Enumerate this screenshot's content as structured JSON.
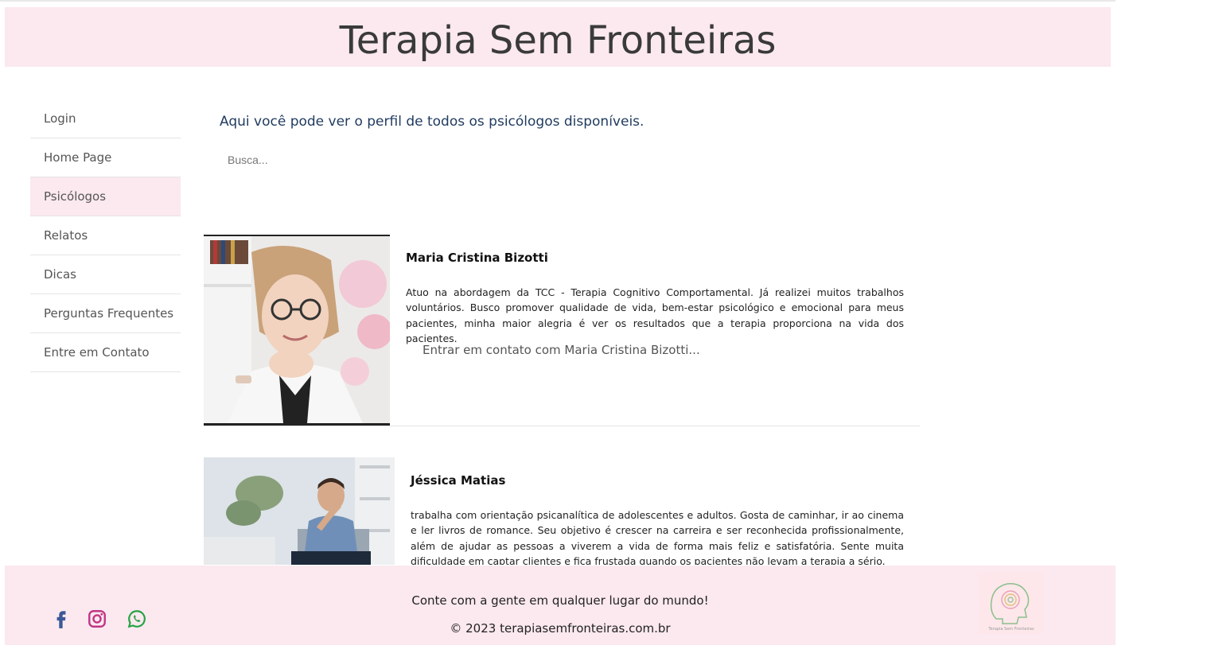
{
  "header": {
    "title": "Terapia Sem Fronteiras"
  },
  "sidebar": {
    "items": [
      {
        "label": "Login"
      },
      {
        "label": "Home Page"
      },
      {
        "label": "Psicólogos",
        "active": true
      },
      {
        "label": "Relatos"
      },
      {
        "label": "Dicas"
      },
      {
        "label": "Perguntas Frequentes"
      },
      {
        "label": "Entre em Contato"
      }
    ]
  },
  "main": {
    "intro": "Aqui você pode ver o perfil de todos os psicólogos disponíveis.",
    "search": {
      "placeholder": "Busca...",
      "value": ""
    }
  },
  "psychologists": [
    {
      "name": "Maria Cristina Bizotti",
      "description": "Atuo na abordagem da TCC - Terapia Cognitivo Comportamental. Já realizei muitos trabalhos voluntários. Busco promover qualidade de vida, bem-estar psicológico e emocional para meus pacientes, minha maior alegria é ver os resultados que a terapia proporciona na vida dos pacientes.",
      "contact": "Entrar em contato com Maria Cristina Bizotti..."
    },
    {
      "name": "Jéssica Matias",
      "description": "trabalha com orientação psicanalítica de adolescentes e adultos. Gosta de caminhar, ir ao cinema e ler livros de romance. Seu objetivo é crescer na carreira e ser reconhecida profissionalmente, além de ajudar as pessoas a viverem a vida de forma mais feliz e satisfatória. Sente muita dificuldade em captar clientes e fica frustada quando os pacientes não levam a terapia a sério."
    }
  ],
  "footer": {
    "message": "Conte com a gente em qualquer lugar do mundo!",
    "copyright": "© 2023 terapiasemfronteiras.com.br",
    "social": [
      {
        "icon": "facebook-icon",
        "color": "#3b5998"
      },
      {
        "icon": "instagram-icon",
        "color": "#c13584"
      },
      {
        "icon": "whatsapp-icon",
        "color": "#25a244"
      }
    ],
    "logo_text": "Terapia Sem Fronteiras"
  },
  "colors": {
    "accent_bg": "#fbe9ef",
    "intro_text": "#1f3a5f"
  }
}
